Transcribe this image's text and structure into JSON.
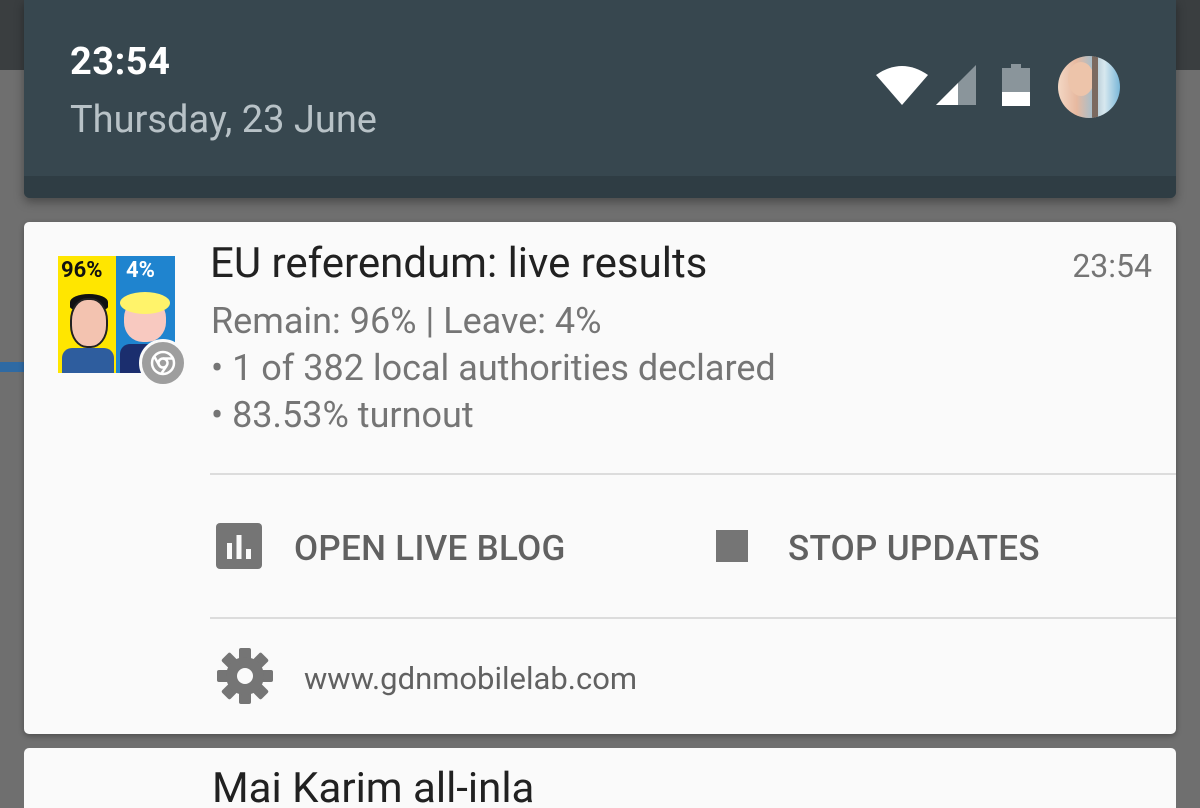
{
  "status": {
    "time": "23:54",
    "date": "Thursday, 23 June",
    "icons": [
      "wifi-icon",
      "cell-signal-icon",
      "battery-icon",
      "user-avatar"
    ]
  },
  "notification": {
    "thumbnail": {
      "remain_pct": "96%",
      "leave_pct": "4%",
      "colors": {
        "remain": "#ffe600",
        "leave": "#1f84cf"
      },
      "badge_icon": "chrome-icon"
    },
    "title": "EU referendum: live results",
    "time": "23:54",
    "lines": [
      "Remain: 96% | Leave: 4%",
      "• 1 of 382 local authorities declared",
      "• 83.53% turnout"
    ],
    "actions": [
      {
        "icon": "bar-chart-icon",
        "label": "OPEN LIVE BLOG"
      },
      {
        "icon": "stop-icon",
        "label": "STOP UPDATES"
      }
    ],
    "footer": {
      "icon": "gear-icon",
      "site": "www.gdnmobilelab.com"
    }
  },
  "next_notification": {
    "title_partial": "Mai Karim all-inla"
  }
}
